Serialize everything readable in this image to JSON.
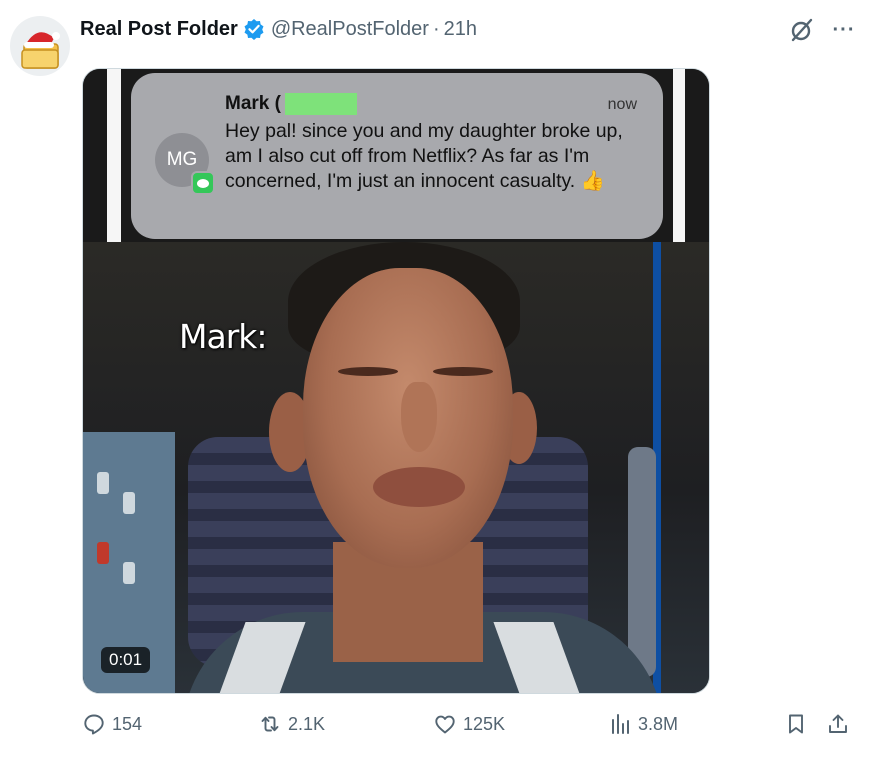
{
  "post": {
    "display_name": "Real Post Folder",
    "handle": "@RealPostFolder",
    "separator": "·",
    "time": "21h"
  },
  "media": {
    "notification": {
      "avatar_initials": "MG",
      "sender": "Mark (",
      "time": "now",
      "message": "Hey pal! since you and my daughter broke up, am I also cut off from Netflix? As far as I'm concerned, I'm just an innocent casualty. 👍"
    },
    "caption": "Mark:",
    "timer": "0:01"
  },
  "actions": {
    "replies": "154",
    "reposts": "2.1K",
    "likes": "125K",
    "views": "3.8M"
  },
  "colors": {
    "verified": "#1d9bf0",
    "muted": "#536471",
    "redaction": "#7ee27a"
  }
}
